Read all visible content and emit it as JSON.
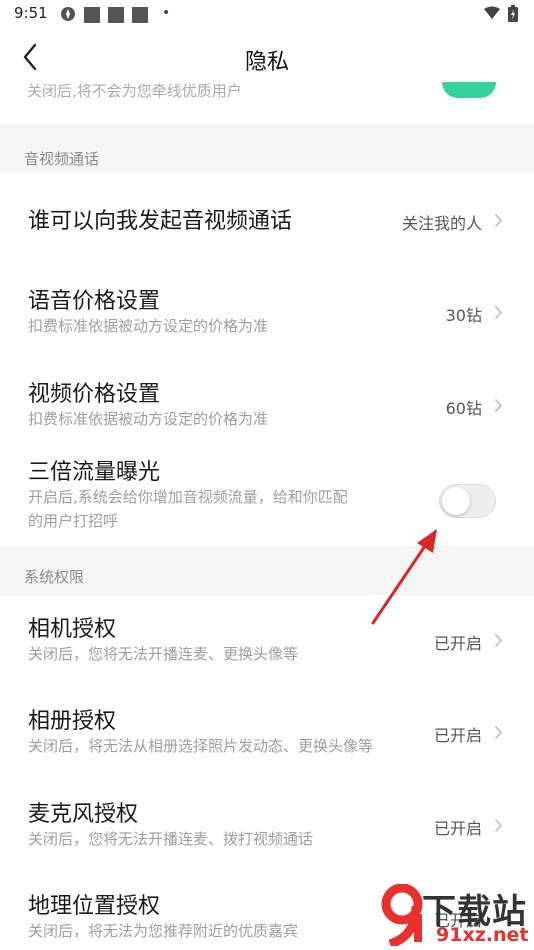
{
  "status_bar": {
    "time": "9:51"
  },
  "header": {
    "title": "隐私"
  },
  "clipped_row": {
    "text": "关闭后,将不会为您牵线优质用户"
  },
  "sections": {
    "av_call": {
      "title": "音视频通话"
    },
    "system": {
      "title": "系统权限"
    }
  },
  "rows": {
    "who_can_call": {
      "title": "谁可以向我发起音视频通话",
      "value": "关注我的人"
    },
    "voice_price": {
      "title": "语音价格设置",
      "desc": "扣费标准依据被动方设定的价格为准",
      "value": "30钻"
    },
    "video_price": {
      "title": "视频价格设置",
      "desc": "扣费标准依据被动方设定的价格为准",
      "value": "60钻"
    },
    "triple_traffic": {
      "title": "三倍流量曝光",
      "desc_line1": "开启后,系统会给你增加音视频流量，给和你匹配",
      "desc_line2": "的用户打招呼",
      "enabled": false
    },
    "camera": {
      "title": "相机授权",
      "desc": "关闭后，您将无法开播连麦、更换头像等",
      "value": "已开启"
    },
    "album": {
      "title": "相册授权",
      "desc": "关闭后，将无法从相册选择照片发动态、更换头像等",
      "value": "已开启"
    },
    "microphone": {
      "title": "麦克风授权",
      "desc": "关闭后，您将无法开播连麦、拨打视频通话",
      "value": "已开启"
    },
    "location": {
      "title": "地理位置授权",
      "desc": "关闭后，将无法为您推荐附近的优质嘉宾",
      "value": "已开启"
    }
  },
  "colors": {
    "toggle_on": "#36d29c",
    "toggle_off": "#eeeeee",
    "section_bg": "#f5f5f5",
    "annotation_arrow": "#d9262a",
    "watermark_red": "#e8302d"
  },
  "watermark": {
    "logo_glyph": "9",
    "main": "下载站",
    "sub": "91xz.net"
  }
}
